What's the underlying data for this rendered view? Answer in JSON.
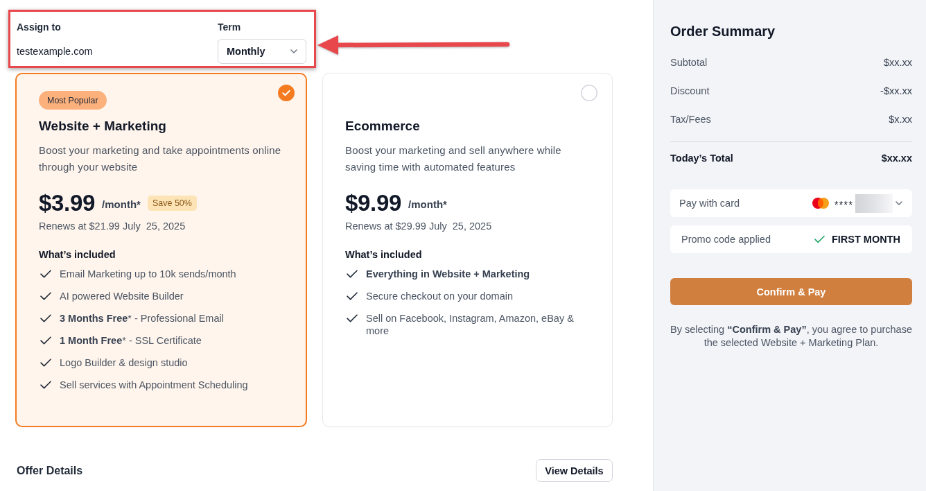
{
  "assignment": {
    "assign_label": "Assign to",
    "assign_value": "testexample.com",
    "term_label": "Term",
    "term_value": "Monthly"
  },
  "annotations": [
    {
      "kind": "box"
    },
    {
      "kind": "arrow"
    }
  ],
  "plans": [
    {
      "selected": true,
      "badge": "Most Popular",
      "title": "Website + Marketing",
      "description": "Boost your marketing and take appointments online through your website",
      "price": "$3.99",
      "period": "/month*",
      "save_badge": "Save 50%",
      "renewal": "Renews at $21.99 July  25, 2025",
      "included_heading": "What’s included",
      "features": [
        {
          "text": "Email Marketing up to 10k sends/month",
          "bold": false
        },
        {
          "text": "AI powered Website Builder",
          "bold": false
        },
        {
          "text": "**3 Months Free*** - Professional Email",
          "bold": false
        },
        {
          "text": "**1 Month Free*** - SSL Certificate",
          "bold": false
        },
        {
          "text": "Logo Builder & design studio",
          "bold": false
        },
        {
          "text": "Sell services with Appointment Scheduling",
          "bold": false
        }
      ]
    },
    {
      "selected": false,
      "title": "Ecommerce",
      "description": "Boost your marketing and sell anywhere while saving time with automated features",
      "price": "$9.99",
      "period": "/month*",
      "renewal": "Renews at $29.99 July  25, 2025",
      "included_heading": "What’s included",
      "features": [
        {
          "text": "Everything in Website + Marketing",
          "bold": true
        },
        {
          "text": "Secure checkout on your domain",
          "bold": false
        },
        {
          "text": "Sell on Facebook, Instagram, Amazon, eBay & more",
          "bold": false
        }
      ]
    }
  ],
  "offer_details": {
    "title": "Offer Details",
    "button": "View Details"
  },
  "order_summary": {
    "title": "Order Summary",
    "rows": [
      {
        "label": "Subtotal",
        "value": "$xx.xx"
      },
      {
        "label": "Discount",
        "value": "-$xx.xx"
      },
      {
        "label": "Tax/Fees",
        "value": "$x.xx"
      }
    ],
    "total": {
      "label": "Today’s Total",
      "value": "$xx.xx"
    },
    "payment": {
      "label": "Pay with card",
      "card_mask": "****"
    },
    "promo": {
      "label": "Promo code applied",
      "code": "FIRST MONTH"
    },
    "confirm_button": "Confirm & Pay",
    "terms": "By selecting **“Confirm & Pay”**, you agree to purchase the selected Website + Marketing Plan."
  }
}
